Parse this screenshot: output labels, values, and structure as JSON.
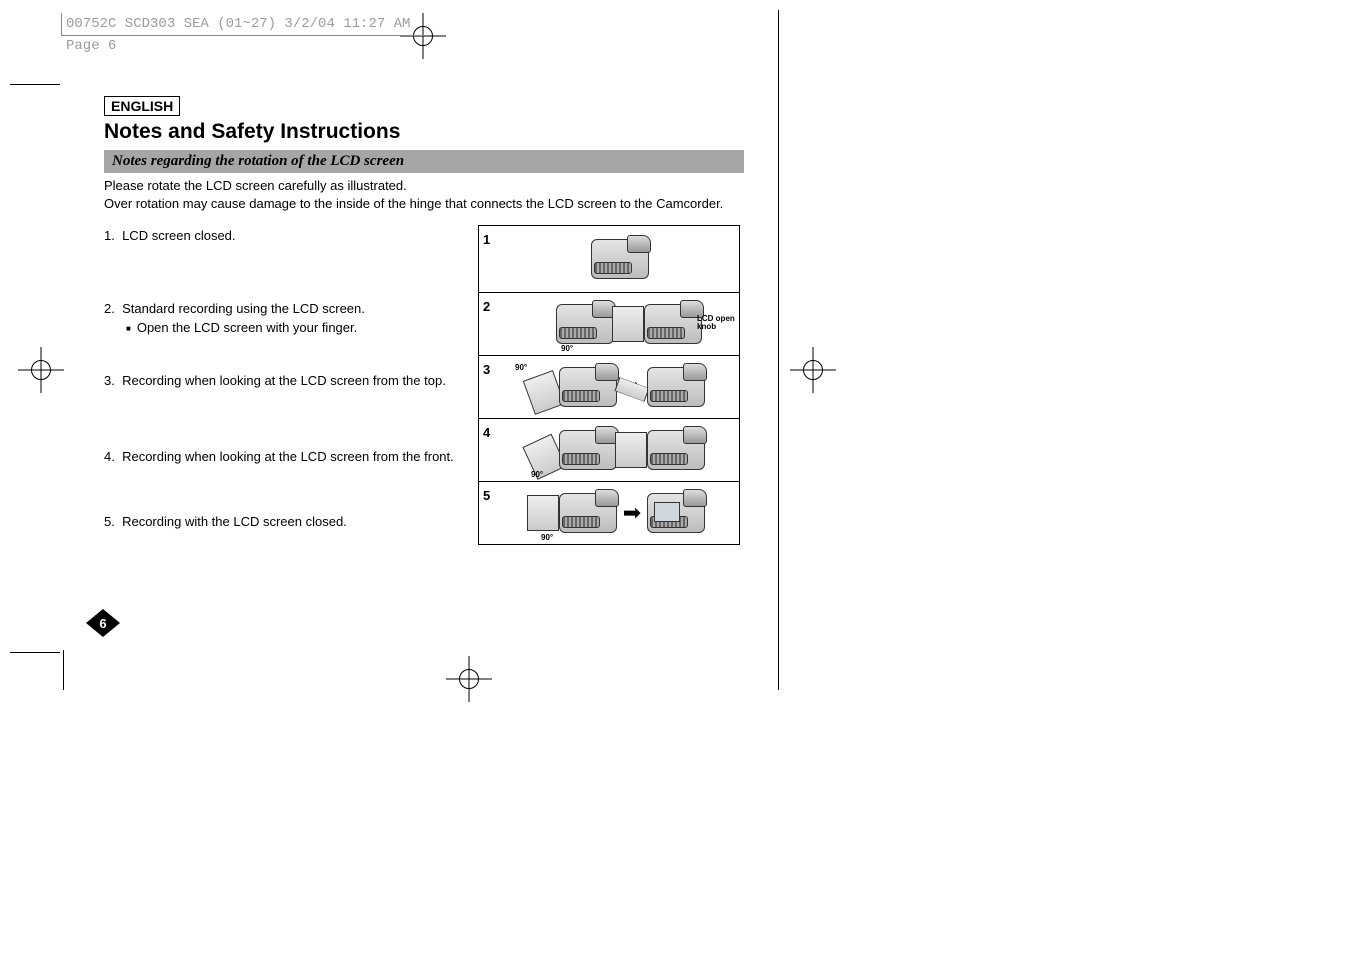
{
  "slug": "00752C SCD303 SEA (01~27)  3/2/04 11:27 AM  Page 6",
  "language_label": "ENGLISH",
  "title": "Notes and Safety Instructions",
  "subhead": "Notes regarding the rotation of the LCD screen",
  "intro_line1": "Please rotate the LCD screen carefully as illustrated.",
  "intro_line2": "Over rotation may cause damage to the inside of the hinge that connects the LCD screen to the Camcorder.",
  "items": [
    {
      "num": "1.",
      "text": "LCD screen closed."
    },
    {
      "num": "2.",
      "text": "Standard recording using the LCD screen.",
      "sub": "Open the LCD screen with your finger."
    },
    {
      "num": "3.",
      "text": "Recording when looking at the LCD screen from the top."
    },
    {
      "num": "4.",
      "text": "Recording when looking at the LCD screen from the front."
    },
    {
      "num": "5.",
      "text": "Recording with the LCD screen closed."
    }
  ],
  "diagram_labels": {
    "row2_angle": "90°",
    "row2_knob": "LCD open knob",
    "row3_angle": "90°",
    "row4_angle": "90°",
    "row5_angle": "90°"
  },
  "diagram_nums": [
    "1",
    "2",
    "3",
    "4",
    "5"
  ],
  "page_number": "6"
}
